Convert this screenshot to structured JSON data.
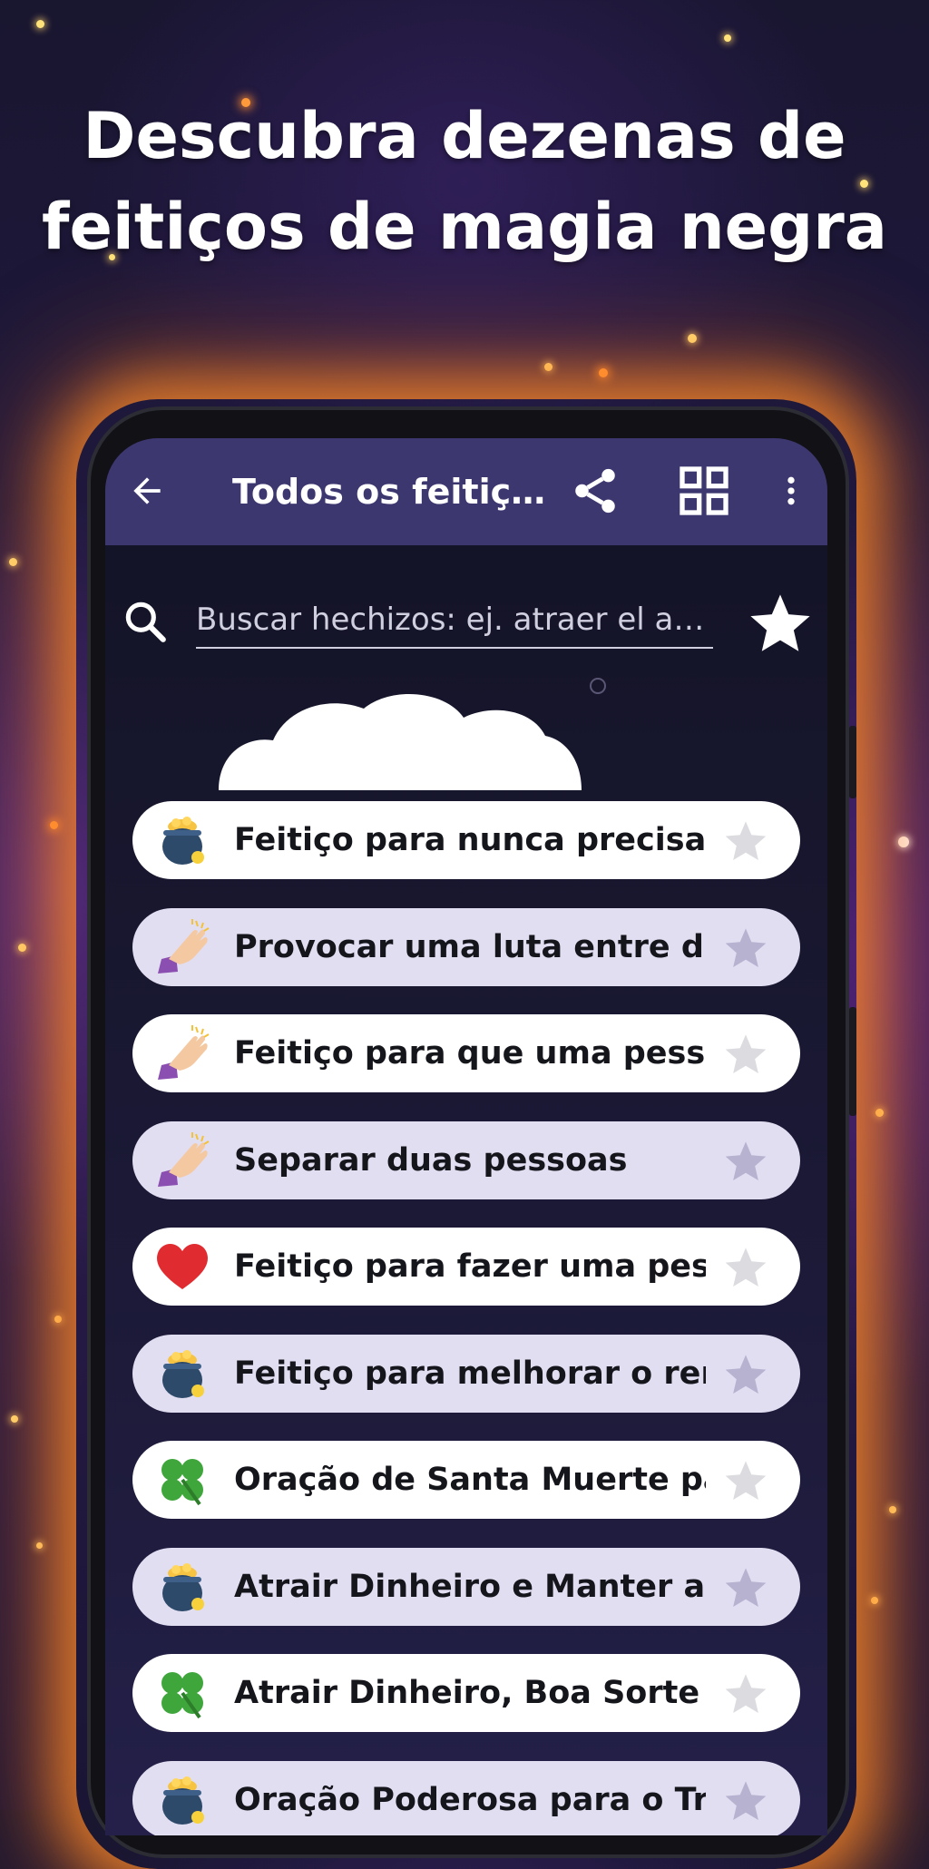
{
  "headline": {
    "line1": "Descubra dezenas de",
    "line2": "feitiços de magia negra"
  },
  "appbar": {
    "back_icon": "arrow-left-icon",
    "title": "Todos os feitiç…",
    "share_icon": "share-icon",
    "grid_icon": "grid-view-icon",
    "menu_icon": "more-vert-icon"
  },
  "search": {
    "icon": "search-icon",
    "placeholder": "Buscar hechizos: ej. atraer el a…",
    "favorites_icon": "star-icon"
  },
  "spells": [
    {
      "label": "Feitiço para nunca precisar …",
      "icon": "pot-of-gold-icon"
    },
    {
      "label": "Provocar uma luta entre dua…",
      "icon": "magic-hand-icon"
    },
    {
      "label": "Feitiço para que uma pessoa…",
      "icon": "magic-hand-icon"
    },
    {
      "label": "Separar duas pessoas",
      "icon": "magic-hand-icon"
    },
    {
      "label": "Feitiço para fazer uma pesso…",
      "icon": "heart-icon"
    },
    {
      "label": "Feitiço para melhorar o rendi…",
      "icon": "pot-of-gold-icon"
    },
    {
      "label": "Oração de Santa Muerte par…",
      "icon": "four-leaf-clover-icon"
    },
    {
      "label": "Atrair Dinheiro e Manter a M…",
      "icon": "pot-of-gold-icon"
    },
    {
      "label": "Atrair Dinheiro, Boa Sorte e …",
      "icon": "four-leaf-clover-icon"
    },
    {
      "label": "Oração Poderosa para o Tra…",
      "icon": "pot-of-gold-icon"
    }
  ],
  "colors": {
    "appbar": "#3d3770",
    "item_light": "#ffffff",
    "item_lavender": "#e2def2",
    "glow": "#ff8c28"
  }
}
